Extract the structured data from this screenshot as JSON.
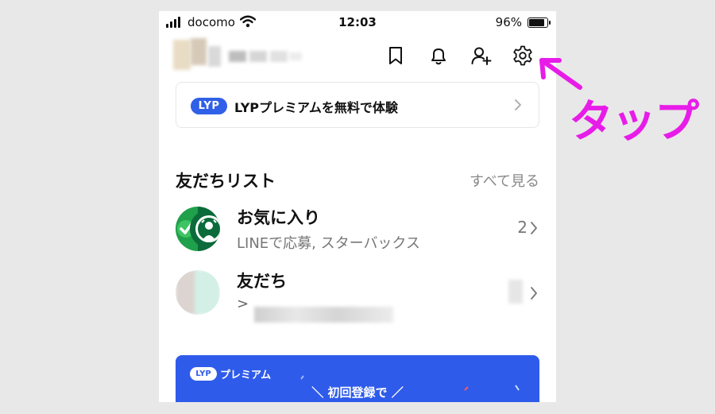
{
  "status_bar": {
    "carrier": "docomo",
    "time": "12:03",
    "battery_percent": "96%",
    "battery_level": 0.96
  },
  "header": {
    "icons": [
      "bookmark-icon",
      "bell-icon",
      "add-friend-icon",
      "settings-icon"
    ]
  },
  "premium_banner": {
    "badge": "LYP",
    "text": "LYPプレミアムを無料で体験"
  },
  "friends": {
    "title": "友だちリスト",
    "see_all": "すべて見る",
    "favorites": {
      "title": "お気に入り",
      "subtitle": "LINEで応募, スターバックス",
      "count": "2"
    },
    "friends_row": {
      "title": "友だち",
      "prefix": ">"
    }
  },
  "promo": {
    "badge": "LYP",
    "name": "プレミアム",
    "tagline": "＼ 初回登録で ／"
  },
  "annotation": {
    "label": "タップ",
    "color": "#e81ce8"
  }
}
